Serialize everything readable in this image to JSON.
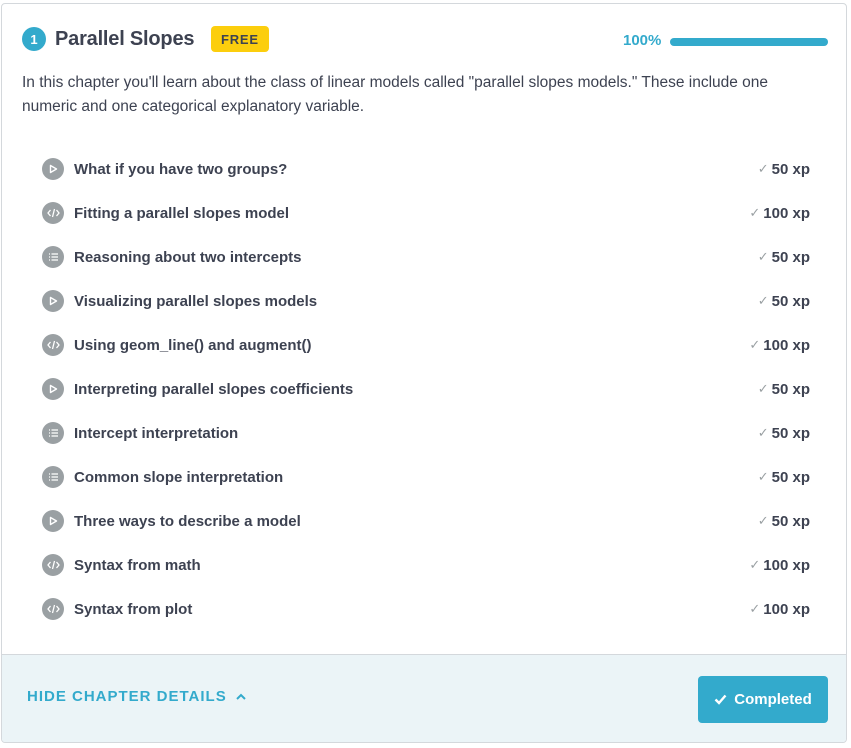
{
  "chapter": {
    "number": "1",
    "title": "Parallel Slopes",
    "badge": "FREE",
    "progress_label": "100%",
    "progress_fraction": 1.0,
    "description": "In this chapter you'll learn about the class of linear models called \"parallel slopes models.\" These include one numeric and one categorical explanatory variable."
  },
  "exercises": [
    {
      "icon": "video-icon",
      "title": "What if you have two groups?",
      "xp": "50 xp"
    },
    {
      "icon": "code-icon",
      "title": "Fitting a parallel slopes model",
      "xp": "100 xp"
    },
    {
      "icon": "list-icon",
      "title": "Reasoning about two intercepts",
      "xp": "50 xp"
    },
    {
      "icon": "video-icon",
      "title": "Visualizing parallel slopes models",
      "xp": "50 xp"
    },
    {
      "icon": "code-icon",
      "title": "Using geom_line() and augment()",
      "xp": "100 xp"
    },
    {
      "icon": "video-icon",
      "title": "Interpreting parallel slopes coefficients",
      "xp": "50 xp"
    },
    {
      "icon": "list-icon",
      "title": "Intercept interpretation",
      "xp": "50 xp"
    },
    {
      "icon": "list-icon",
      "title": "Common slope interpretation",
      "xp": "50 xp"
    },
    {
      "icon": "video-icon",
      "title": "Three ways to describe a model",
      "xp": "50 xp"
    },
    {
      "icon": "code-icon",
      "title": "Syntax from math",
      "xp": "100 xp"
    },
    {
      "icon": "code-icon",
      "title": "Syntax from plot",
      "xp": "100 xp"
    }
  ],
  "footer": {
    "hide_details_label": "HIDE CHAPTER DETAILS",
    "completed_label": "Completed"
  },
  "colors": {
    "accent": "#33aacc",
    "badge": "#fcce0d",
    "footer_bg": "#ebf4f7",
    "icon_bg": "#9aa0a3"
  }
}
